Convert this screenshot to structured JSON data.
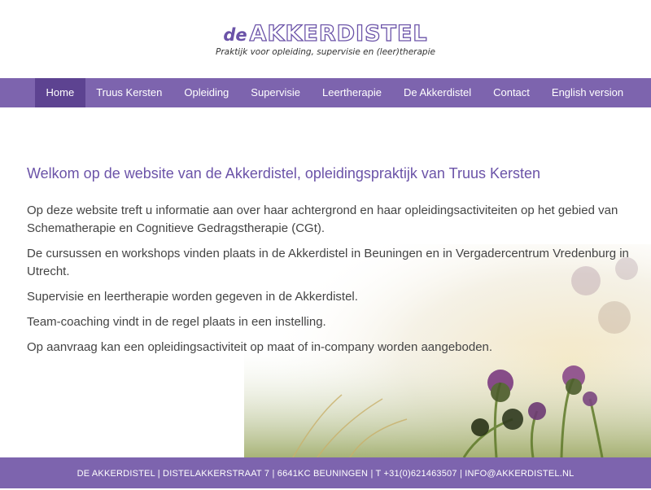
{
  "brand": {
    "prefix": "de",
    "name": "AKKERDISTEL",
    "tagline": "Praktijk voor opleiding, supervisie en (leer)therapie",
    "accent_color": "#6b53a8",
    "nav_color": "#7d64ae",
    "nav_active_color": "#5d4391"
  },
  "nav": {
    "items": [
      {
        "label": "Home",
        "active": true
      },
      {
        "label": "Truus Kersten"
      },
      {
        "label": "Opleiding"
      },
      {
        "label": "Supervisie"
      },
      {
        "label": "Leertherapie"
      },
      {
        "label": "De Akkerdistel"
      },
      {
        "label": "Contact"
      },
      {
        "label": "English version"
      }
    ]
  },
  "main": {
    "heading": "Welkom op de website van de Akkerdistel, opleidingspraktijk van Truus Kersten",
    "paragraphs": [
      "Op deze website treft u informatie aan over haar achtergrond en haar opleidingsactiviteiten op het gebied van Schematherapie en Cognitieve Gedragstherapie (CGt).",
      "De cursussen en workshops vinden plaats in de Akkerdistel in Beuningen en in Vergadercentrum Vredenburg in Utrecht.",
      "Supervisie en leertherapie worden gegeven in de Akkerdistel.",
      "Team-coaching vindt in de regel plaats in een instelling.",
      "Op aanvraag kan een opleidingsactiviteit op maat of in-company worden aangeboden."
    ]
  },
  "footer": {
    "text": "DE AKKERDISTEL | DISTELAKKERSTRAAT 7 | 6641KC BEUNINGEN | T +31(0)621463507 | INFO@AKKERDISTEL.NL"
  }
}
